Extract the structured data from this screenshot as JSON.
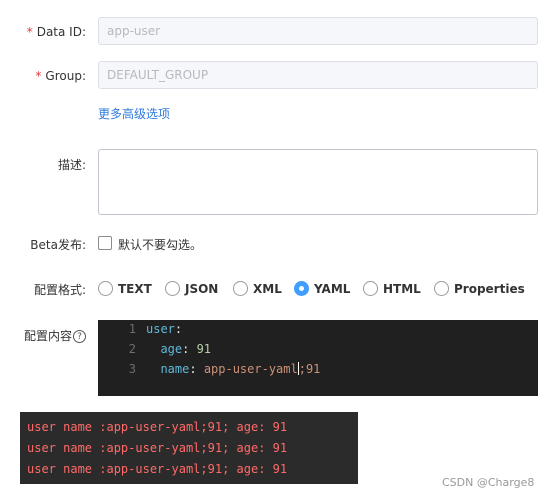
{
  "form": {
    "data_id": {
      "required_mark": "*",
      "label": "Data ID:",
      "value": "app-user"
    },
    "group": {
      "required_mark": "*",
      "label": "Group:",
      "value": "DEFAULT_GROUP"
    },
    "advanced_link": "更多高级选项",
    "description": {
      "label": "描述:",
      "value": ""
    },
    "beta": {
      "label": "Beta发布:",
      "checkbox_label": "默认不要勾选。",
      "checked": false
    },
    "format": {
      "label": "配置格式:",
      "options": [
        "TEXT",
        "JSON",
        "XML",
        "YAML",
        "HTML",
        "Properties"
      ],
      "selected": "YAML"
    },
    "content": {
      "label": "配置内容",
      "help_icon": "question-circle-icon",
      "lines": [
        {
          "num": "1",
          "key": "user",
          "sep": ":",
          "value": ""
        },
        {
          "num": "2",
          "key": "  age",
          "sep": ": ",
          "value": "91"
        },
        {
          "num": "3",
          "key": "  name",
          "sep": ": ",
          "value_a": "app-user-yaml",
          "value_b": ";91"
        }
      ]
    }
  },
  "console": {
    "lines": [
      "user name :app-user-yaml;91; age: 91",
      "user name :app-user-yaml;91; age: 91",
      "user name :app-user-yaml;91; age: 91"
    ]
  },
  "watermark": "CSDN @Charge8",
  "colors": {
    "required": "#e4393c",
    "link": "#2f7bdc",
    "radio_selected": "#409eff",
    "editor_bg": "#202020",
    "console_bg": "#2b2b2b",
    "console_text": "#ff6b68"
  }
}
